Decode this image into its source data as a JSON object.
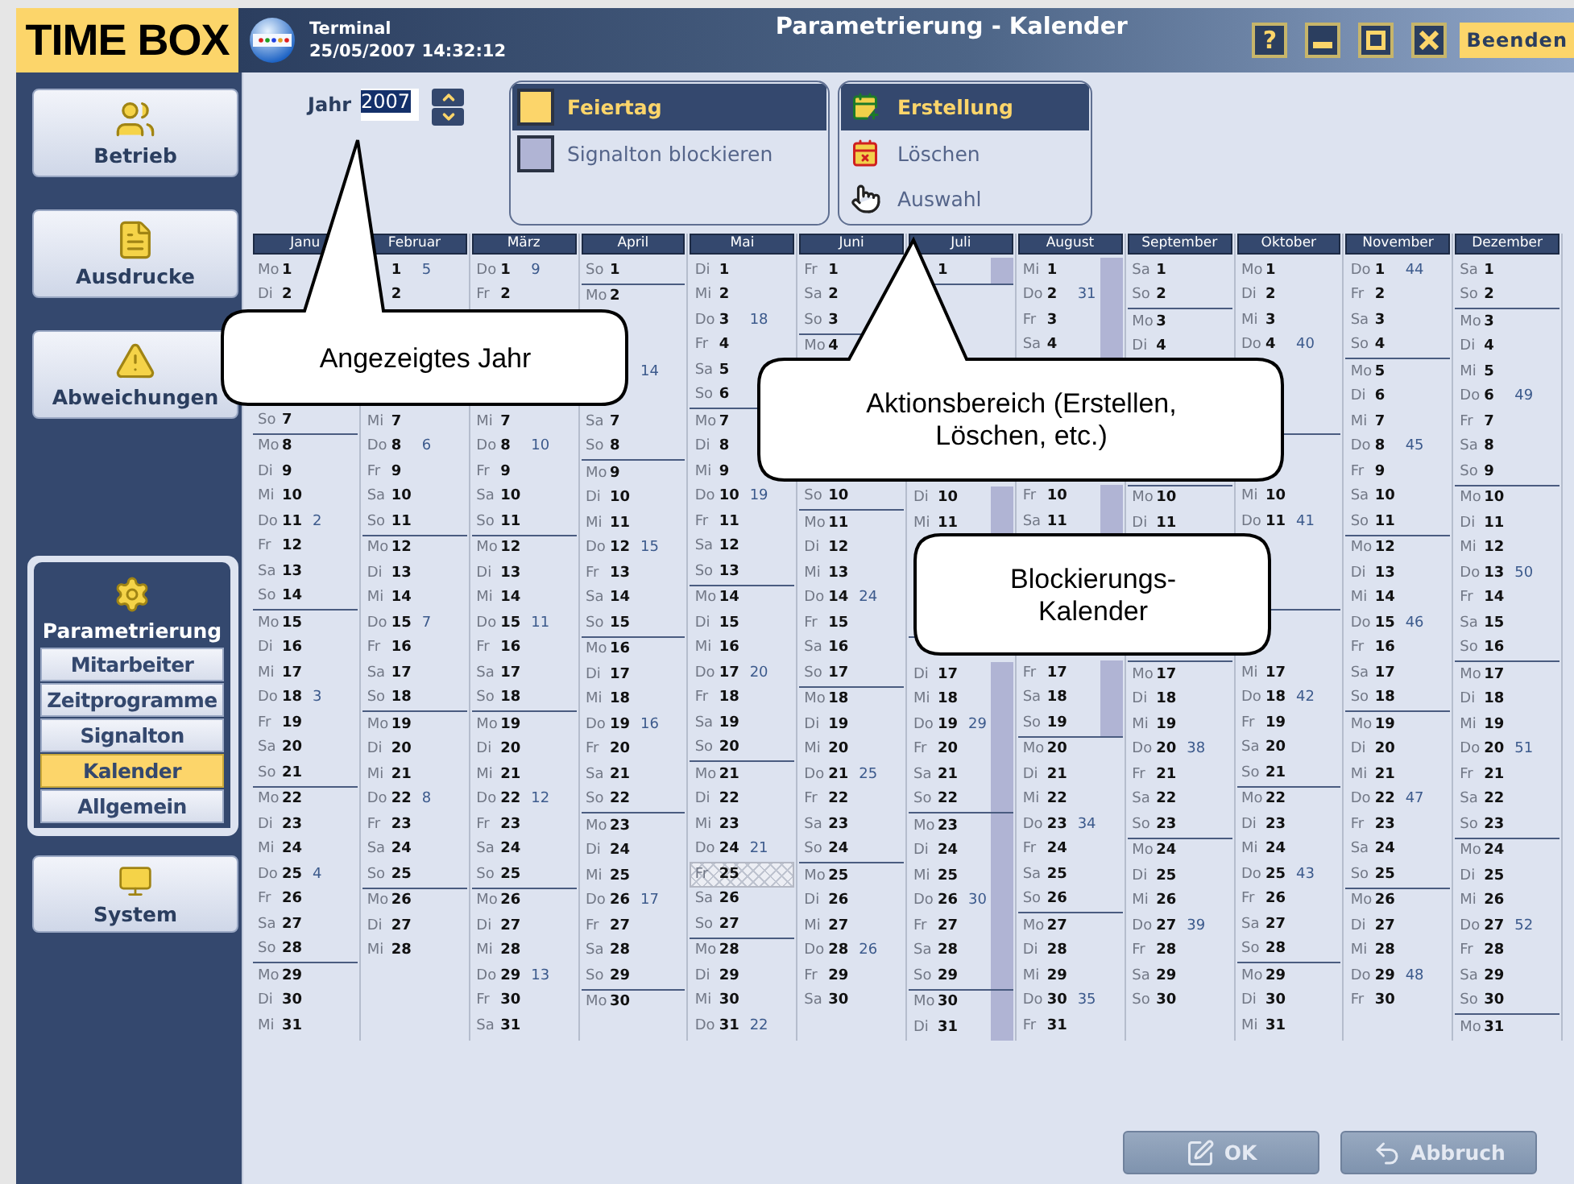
{
  "window": {
    "logo": "TIME BOX",
    "terminal_label": "Terminal",
    "datetime": "25/05/2007 14:32:12",
    "title": "Parametrierung - Kalender",
    "help": "?",
    "exit": "Beenden"
  },
  "sidebar": [
    {
      "label": "Betrieb",
      "selected": false
    },
    {
      "label": "Ausdrucke",
      "selected": false
    },
    {
      "label": "Abweichungen",
      "selected": false
    },
    {
      "label": "Parametrierung",
      "selected": true,
      "children": [
        {
          "label": "Mitarbeiter",
          "selected": false
        },
        {
          "label": "Zeitprogramme",
          "selected": false
        },
        {
          "label": "Signalton",
          "selected": false
        },
        {
          "label": "Kalender",
          "selected": true
        },
        {
          "label": "Allgemein",
          "selected": false
        }
      ]
    },
    {
      "label": "System",
      "selected": false
    }
  ],
  "year": {
    "label": "Jahr",
    "value": "2007"
  },
  "legend": [
    {
      "label": "Feiertag",
      "color": "#fcd56a",
      "selected": true
    },
    {
      "label": "Signalton blockieren",
      "color": "#b0b4d4",
      "selected": false
    }
  ],
  "actions": [
    {
      "label": "Erstellung",
      "selected": true
    },
    {
      "label": "Löschen",
      "selected": false
    },
    {
      "label": "Auswahl",
      "selected": false
    }
  ],
  "calendar": {
    "months": [
      {
        "name": "Janu",
        "weeks": [
          [
            [
              "Mo",
              "1"
            ],
            [
              "Di",
              "2"
            ],
            {
              "kind": "covered"
            },
            {
              "kind": "covered"
            },
            {
              "kind": "covered"
            },
            {
              "kind": "covered"
            },
            [
              "So",
              "7"
            ]
          ],
          [
            [
              "Mo",
              "8"
            ],
            [
              "Di",
              "9"
            ],
            [
              "Mi",
              "10"
            ],
            [
              "Do",
              "11",
              "2"
            ],
            [
              "Fr",
              "12"
            ],
            [
              "Sa",
              "13"
            ],
            [
              "So",
              "14"
            ]
          ],
          [
            [
              "Mo",
              "15"
            ],
            [
              "Di",
              "16"
            ],
            [
              "Mi",
              "17"
            ],
            [
              "Do",
              "18",
              "3"
            ],
            [
              "Fr",
              "19"
            ],
            [
              "Sa",
              "20"
            ],
            [
              "So",
              "21"
            ]
          ],
          [
            [
              "Mo",
              "22"
            ],
            [
              "Di",
              "23"
            ],
            [
              "Mi",
              "24"
            ],
            [
              "Do",
              "25",
              "4"
            ],
            [
              "Fr",
              "26"
            ],
            [
              "Sa",
              "27"
            ],
            [
              "So",
              "28"
            ]
          ],
          [
            [
              "Mo",
              "29"
            ],
            [
              "Di",
              "30"
            ],
            [
              "Mi",
              "31"
            ]
          ]
        ]
      },
      {
        "name": "Februar",
        "weeks": [
          [
            {
              "kind": "day",
              "date": "1",
              "week": "5"
            },
            {
              "kind": "day",
              "date": "2"
            },
            {
              "kind": "covered"
            },
            {
              "kind": "covered"
            }
          ],
          [
            {
              "kind": "covered"
            },
            {
              "kind": "covered"
            },
            [
              "Mi",
              "7"
            ],
            [
              "Do",
              "8",
              "6"
            ],
            [
              "Fr",
              "9"
            ],
            [
              "Sa",
              "10"
            ],
            [
              "So",
              "11"
            ]
          ],
          [
            [
              "Mo",
              "12"
            ],
            [
              "Di",
              "13"
            ],
            [
              "Mi",
              "14"
            ],
            [
              "Do",
              "15",
              "7"
            ],
            [
              "Fr",
              "16"
            ],
            [
              "Sa",
              "17"
            ],
            [
              "So",
              "18"
            ]
          ],
          [
            [
              "Mo",
              "19"
            ],
            [
              "Di",
              "20"
            ],
            [
              "Mi",
              "21"
            ],
            [
              "Do",
              "22",
              "8"
            ],
            [
              "Fr",
              "23"
            ],
            [
              "Sa",
              "24"
            ],
            [
              "So",
              "25"
            ]
          ],
          [
            [
              "Mo",
              "26"
            ],
            [
              "Di",
              "27"
            ],
            [
              "Mi",
              "28"
            ]
          ]
        ]
      },
      {
        "name": "März",
        "weeks": [
          [
            [
              "Do",
              "1",
              "9"
            ],
            [
              "Fr",
              "2"
            ],
            {
              "kind": "covered"
            },
            {
              "kind": "covered"
            }
          ],
          [
            {
              "kind": "covered"
            },
            {
              "kind": "covered"
            },
            [
              "Mi",
              "7"
            ],
            [
              "Do",
              "8",
              "10"
            ],
            [
              "Fr",
              "9"
            ],
            [
              "Sa",
              "10"
            ],
            [
              "So",
              "11"
            ]
          ],
          [
            [
              "Mo",
              "12"
            ],
            [
              "Di",
              "13"
            ],
            [
              "Mi",
              "14"
            ],
            [
              "Do",
              "15",
              "11"
            ],
            [
              "Fr",
              "16"
            ],
            [
              "Sa",
              "17"
            ],
            [
              "So",
              "18"
            ]
          ],
          [
            [
              "Mo",
              "19"
            ],
            [
              "Di",
              "20"
            ],
            [
              "Mi",
              "21"
            ],
            [
              "Do",
              "22",
              "12"
            ],
            [
              "Fr",
              "23"
            ],
            [
              "Sa",
              "24"
            ],
            [
              "So",
              "25"
            ]
          ],
          [
            [
              "Mo",
              "26"
            ],
            [
              "Di",
              "27"
            ],
            [
              "Mi",
              "28"
            ],
            [
              "Do",
              "29",
              "13"
            ],
            [
              "Fr",
              "30"
            ],
            [
              "Sa",
              "31"
            ]
          ]
        ]
      },
      {
        "name": "April",
        "weeks": [
          [
            [
              "So",
              "1"
            ]
          ],
          [
            [
              "Mo",
              "2"
            ],
            {
              "kind": "covered"
            },
            {
              "kind": "covered"
            },
            {
              "kind": "day",
              "week": "14"
            },
            {
              "kind": "covered"
            },
            [
              "Sa",
              "7"
            ],
            [
              "So",
              "8"
            ]
          ],
          [
            [
              "Mo",
              "9"
            ],
            [
              "Di",
              "10"
            ],
            [
              "Mi",
              "11"
            ],
            [
              "Do",
              "12",
              "15"
            ],
            [
              "Fr",
              "13"
            ],
            [
              "Sa",
              "14"
            ],
            [
              "So",
              "15"
            ]
          ],
          [
            [
              "Mo",
              "16"
            ],
            [
              "Di",
              "17"
            ],
            [
              "Mi",
              "18"
            ],
            [
              "Do",
              "19",
              "16"
            ],
            [
              "Fr",
              "20"
            ],
            [
              "Sa",
              "21"
            ],
            [
              "So",
              "22"
            ]
          ],
          [
            [
              "Mo",
              "23"
            ],
            [
              "Di",
              "24"
            ],
            [
              "Mi",
              "25"
            ],
            [
              "Do",
              "26",
              "17"
            ],
            [
              "Fr",
              "27"
            ],
            [
              "Sa",
              "28"
            ],
            [
              "So",
              "29"
            ]
          ],
          [
            [
              "Mo",
              "30"
            ]
          ]
        ]
      },
      {
        "name": "Mai",
        "weeks": [
          [
            [
              "Di",
              "1"
            ],
            [
              "Mi",
              "2"
            ],
            [
              "Do",
              "3",
              "18"
            ],
            [
              "Fr",
              "4"
            ],
            [
              "Sa",
              "5"
            ],
            [
              "So",
              "6"
            ]
          ],
          [
            [
              "Mo",
              "7"
            ],
            [
              "Di",
              "8"
            ],
            [
              "Mi",
              "9"
            ],
            [
              "Do",
              "10",
              "19"
            ],
            [
              "Fr",
              "11"
            ],
            [
              "Sa",
              "12"
            ],
            [
              "So",
              "13"
            ]
          ],
          [
            [
              "Mo",
              "14"
            ],
            [
              "Di",
              "15"
            ],
            [
              "Mi",
              "16"
            ],
            [
              "Do",
              "17",
              "20"
            ],
            [
              "Fr",
              "18"
            ],
            [
              "Sa",
              "19"
            ],
            [
              "So",
              "20"
            ]
          ],
          [
            [
              "Mo",
              "21"
            ],
            [
              "Di",
              "22"
            ],
            [
              "Mi",
              "23"
            ],
            [
              "Do",
              "24",
              "21"
            ],
            {
              "kind": "day",
              "weekday": "Fr",
              "date": "25",
              "hatched": true
            },
            [
              "Sa",
              "26"
            ],
            [
              "So",
              "27"
            ]
          ],
          [
            [
              "Mo",
              "28"
            ],
            [
              "Di",
              "29"
            ],
            [
              "Mi",
              "30"
            ],
            [
              "Do",
              "31",
              "22"
            ]
          ]
        ]
      },
      {
        "name": "Juni",
        "weeks": [
          [
            [
              "Fr",
              "1"
            ],
            [
              "Sa",
              "2"
            ],
            [
              "So",
              "3"
            ]
          ],
          [
            [
              "Mo",
              "4"
            ],
            {
              "kind": "covered"
            },
            {
              "kind": "covered"
            },
            {
              "kind": "covered"
            },
            {
              "kind": "covered"
            },
            {
              "kind": "covered"
            },
            [
              "So",
              "10"
            ]
          ],
          [
            [
              "Mo",
              "11"
            ],
            [
              "Di",
              "12"
            ],
            [
              "Mi",
              "13"
            ],
            [
              "Do",
              "14",
              "24"
            ],
            [
              "Fr",
              "15"
            ],
            [
              "Sa",
              "16"
            ],
            [
              "So",
              "17"
            ]
          ],
          [
            [
              "Mo",
              "18"
            ],
            [
              "Di",
              "19"
            ],
            [
              "Mi",
              "20"
            ],
            [
              "Do",
              "21",
              "25"
            ],
            [
              "Fr",
              "22"
            ],
            [
              "Sa",
              "23"
            ],
            [
              "So",
              "24"
            ]
          ],
          [
            [
              "Mo",
              "25"
            ],
            [
              "Di",
              "26"
            ],
            [
              "Mi",
              "27"
            ],
            [
              "Do",
              "28",
              "26"
            ],
            [
              "Fr",
              "29"
            ],
            [
              "Sa",
              "30"
            ]
          ]
        ]
      },
      {
        "name": "Juli",
        "weeks": [
          [
            {
              "kind": "day",
              "date": "1",
              "blocked": true
            }
          ],
          [
            {
              "kind": "covered"
            },
            {
              "kind": "covered"
            },
            {
              "kind": "covered"
            },
            {
              "kind": "covered"
            },
            {
              "kind": "covered"
            },
            {
              "kind": "covered"
            },
            {
              "kind": "covered"
            }
          ],
          [
            {
              "kind": "covered"
            },
            {
              "kind": "day",
              "weekday": "Di",
              "date": "10",
              "blocked": true
            },
            {
              "kind": "day",
              "weekday": "Mi",
              "date": "11",
              "blocked": true
            },
            {
              "kind": "covered"
            },
            {
              "kind": "covered"
            },
            {
              "kind": "covered"
            },
            {
              "kind": "covered"
            }
          ],
          [
            {
              "kind": "covered"
            },
            {
              "kind": "day",
              "weekday": "Di",
              "date": "17",
              "blocked": true
            },
            {
              "kind": "day",
              "weekday": "Mi",
              "date": "18",
              "blocked": true
            },
            {
              "kind": "day",
              "weekday": "Do",
              "date": "19",
              "week": "29",
              "blocked": true
            },
            {
              "kind": "day",
              "weekday": "Fr",
              "date": "20",
              "blocked": true
            },
            {
              "kind": "day",
              "weekday": "Sa",
              "date": "21",
              "blocked": true
            },
            {
              "kind": "day",
              "weekday": "So",
              "date": "22",
              "blocked": true
            }
          ],
          [
            {
              "kind": "day",
              "weekday": "Mo",
              "date": "23",
              "blocked": true
            },
            {
              "kind": "day",
              "weekday": "Di",
              "date": "24",
              "blocked": true
            },
            {
              "kind": "day",
              "weekday": "Mi",
              "date": "25",
              "blocked": true
            },
            {
              "kind": "day",
              "weekday": "Do",
              "date": "26",
              "week": "30",
              "blocked": true
            },
            {
              "kind": "day",
              "weekday": "Fr",
              "date": "27",
              "blocked": true
            },
            {
              "kind": "day",
              "weekday": "Sa",
              "date": "28",
              "blocked": true
            },
            {
              "kind": "day",
              "weekday": "So",
              "date": "29",
              "blocked": true
            }
          ],
          [
            {
              "kind": "day",
              "weekday": "Mo",
              "date": "30",
              "blocked": true
            },
            {
              "kind": "day",
              "weekday": "Di",
              "date": "31",
              "blocked": true
            }
          ]
        ]
      },
      {
        "name": "August",
        "weeks": [
          [
            {
              "kind": "day",
              "weekday": "Mi",
              "date": "1",
              "blocked": true
            },
            {
              "kind": "day",
              "weekday": "Do",
              "date": "2",
              "week": "31",
              "blocked": true
            },
            {
              "kind": "day",
              "weekday": "Fr",
              "date": "3",
              "blocked": true
            },
            {
              "kind": "day",
              "weekday": "Sa",
              "date": "4",
              "blocked": true
            },
            {
              "kind": "covered"
            }
          ],
          [
            {
              "kind": "covered"
            },
            {
              "kind": "covered"
            },
            {
              "kind": "covered"
            },
            {
              "kind": "covered"
            },
            {
              "kind": "day",
              "weekday": "Fr",
              "date": "10",
              "blocked": true
            },
            {
              "kind": "day",
              "weekday": "Sa",
              "date": "11",
              "blocked": true
            },
            {
              "kind": "covered"
            }
          ],
          [
            {
              "kind": "covered"
            },
            {
              "kind": "covered"
            },
            {
              "kind": "covered"
            },
            {
              "kind": "covered"
            },
            {
              "kind": "day",
              "weekday": "Fr",
              "date": "17",
              "blocked": true
            },
            {
              "kind": "day",
              "weekday": "Sa",
              "date": "18",
              "blocked": true
            },
            {
              "kind": "day",
              "weekday": "So",
              "date": "19",
              "blocked": true
            }
          ],
          [
            [
              "Mo",
              "20"
            ],
            [
              "Di",
              "21"
            ],
            [
              "Mi",
              "22"
            ],
            [
              "Do",
              "23",
              "34"
            ],
            [
              "Fr",
              "24"
            ],
            [
              "Sa",
              "25"
            ],
            [
              "So",
              "26"
            ]
          ],
          [
            [
              "Mo",
              "27"
            ],
            [
              "Di",
              "28"
            ],
            [
              "Mi",
              "29"
            ],
            [
              "Do",
              "30",
              "35"
            ],
            [
              "Fr",
              "31"
            ]
          ]
        ]
      },
      {
        "name": "September",
        "weeks": [
          [
            [
              "Sa",
              "1"
            ],
            [
              "So",
              "2"
            ]
          ],
          [
            [
              "Mo",
              "3"
            ],
            [
              "Di",
              "4"
            ],
            {
              "kind": "covered"
            },
            {
              "kind": "covered"
            },
            {
              "kind": "covered"
            },
            {
              "kind": "covered"
            },
            {
              "kind": "covered"
            }
          ],
          [
            [
              "Mo",
              "10"
            ],
            [
              "Di",
              "11"
            ],
            {
              "kind": "covered"
            },
            {
              "kind": "covered"
            },
            {
              "kind": "covered"
            },
            {
              "kind": "covered"
            },
            {
              "kind": "covered"
            }
          ],
          [
            [
              "Mo",
              "17"
            ],
            [
              "Di",
              "18"
            ],
            [
              "Mi",
              "19"
            ],
            [
              "Do",
              "20",
              "38"
            ],
            [
              "Fr",
              "21"
            ],
            [
              "Sa",
              "22"
            ],
            [
              "So",
              "23"
            ]
          ],
          [
            [
              "Mo",
              "24"
            ],
            [
              "Di",
              "25"
            ],
            [
              "Mi",
              "26"
            ],
            [
              "Do",
              "27",
              "39"
            ],
            [
              "Fr",
              "28"
            ],
            [
              "Sa",
              "29"
            ],
            [
              "So",
              "30"
            ]
          ]
        ]
      },
      {
        "name": "Oktober",
        "weeks": [
          [
            [
              "Mo",
              "1"
            ],
            [
              "Di",
              "2"
            ],
            [
              "Mi",
              "3"
            ],
            [
              "Do",
              "4",
              "40"
            ],
            {
              "kind": "covered"
            },
            {
              "kind": "covered"
            },
            {
              "kind": "covered"
            }
          ],
          [
            {
              "kind": "covered"
            },
            {
              "kind": "covered"
            },
            [
              "Mi",
              "10"
            ],
            [
              "Do",
              "11",
              "41"
            ],
            {
              "kind": "covered"
            },
            {
              "kind": "covered"
            },
            {
              "kind": "covered"
            }
          ],
          [
            {
              "kind": "covered"
            },
            {
              "kind": "covered"
            },
            [
              "Mi",
              "17"
            ],
            [
              "Do",
              "18",
              "42"
            ],
            [
              "Fr",
              "19"
            ],
            [
              "Sa",
              "20"
            ],
            [
              "So",
              "21"
            ]
          ],
          [
            [
              "Mo",
              "22"
            ],
            [
              "Di",
              "23"
            ],
            [
              "Mi",
              "24"
            ],
            [
              "Do",
              "25",
              "43"
            ],
            [
              "Fr",
              "26"
            ],
            [
              "Sa",
              "27"
            ],
            [
              "So",
              "28"
            ]
          ],
          [
            [
              "Mo",
              "29"
            ],
            [
              "Di",
              "30"
            ],
            [
              "Mi",
              "31"
            ]
          ]
        ]
      },
      {
        "name": "November",
        "weeks": [
          [
            [
              "Do",
              "1",
              "44"
            ],
            [
              "Fr",
              "2"
            ],
            [
              "Sa",
              "3"
            ],
            [
              "So",
              "4"
            ]
          ],
          [
            [
              "Mo",
              "5"
            ],
            [
              "Di",
              "6"
            ],
            [
              "Mi",
              "7"
            ],
            [
              "Do",
              "8",
              "45"
            ],
            [
              "Fr",
              "9"
            ],
            [
              "Sa",
              "10"
            ],
            [
              "So",
              "11"
            ]
          ],
          [
            [
              "Mo",
              "12"
            ],
            [
              "Di",
              "13"
            ],
            [
              "Mi",
              "14"
            ],
            [
              "Do",
              "15",
              "46"
            ],
            [
              "Fr",
              "16"
            ],
            [
              "Sa",
              "17"
            ],
            [
              "So",
              "18"
            ]
          ],
          [
            [
              "Mo",
              "19"
            ],
            [
              "Di",
              "20"
            ],
            [
              "Mi",
              "21"
            ],
            [
              "Do",
              "22",
              "47"
            ],
            [
              "Fr",
              "23"
            ],
            [
              "Sa",
              "24"
            ],
            [
              "So",
              "25"
            ]
          ],
          [
            [
              "Mo",
              "26"
            ],
            [
              "Di",
              "27"
            ],
            [
              "Mi",
              "28"
            ],
            [
              "Do",
              "29",
              "48"
            ],
            [
              "Fr",
              "30"
            ]
          ]
        ]
      },
      {
        "name": "Dezember",
        "weeks": [
          [
            [
              "Sa",
              "1"
            ],
            [
              "So",
              "2"
            ]
          ],
          [
            [
              "Mo",
              "3"
            ],
            [
              "Di",
              "4"
            ],
            [
              "Mi",
              "5"
            ],
            [
              "Do",
              "6",
              "49"
            ],
            [
              "Fr",
              "7"
            ],
            [
              "Sa",
              "8"
            ],
            [
              "So",
              "9"
            ]
          ],
          [
            [
              "Mo",
              "10"
            ],
            [
              "Di",
              "11"
            ],
            [
              "Mi",
              "12"
            ],
            [
              "Do",
              "13",
              "50"
            ],
            [
              "Fr",
              "14"
            ],
            [
              "Sa",
              "15"
            ],
            [
              "So",
              "16"
            ]
          ],
          [
            [
              "Mo",
              "17"
            ],
            [
              "Di",
              "18"
            ],
            [
              "Mi",
              "19"
            ],
            [
              "Do",
              "20",
              "51"
            ],
            [
              "Fr",
              "21"
            ],
            [
              "Sa",
              "22"
            ],
            [
              "So",
              "23"
            ]
          ],
          [
            [
              "Mo",
              "24"
            ],
            [
              "Di",
              "25"
            ],
            [
              "Mi",
              "26"
            ],
            [
              "Do",
              "27",
              "52"
            ],
            [
              "Fr",
              "28"
            ],
            [
              "Sa",
              "29"
            ],
            [
              "So",
              "30"
            ]
          ],
          [
            [
              "Mo",
              "31"
            ]
          ]
        ]
      }
    ]
  },
  "callouts": [
    {
      "text": "Angezeigtes Jahr"
    },
    {
      "text": "Aktionsbereich (Erstellen, Löschen, etc.)"
    },
    {
      "text": "Blockierungs-Kalender"
    }
  ],
  "buttons": [
    {
      "label": "OK",
      "disabled": true
    },
    {
      "label": "Abbruch",
      "disabled": true
    }
  ]
}
